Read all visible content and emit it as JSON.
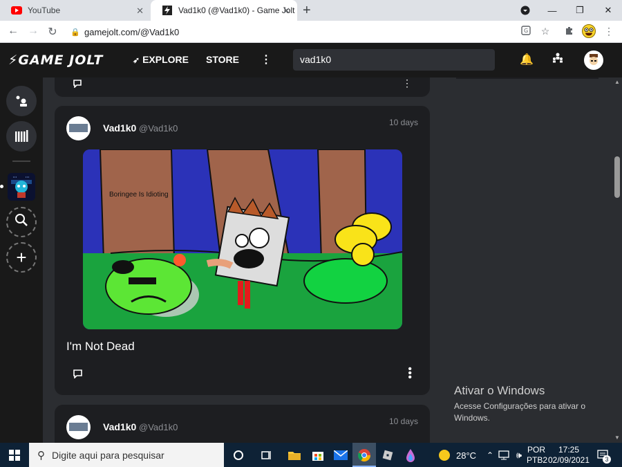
{
  "browser": {
    "tabs": [
      {
        "title": "YouTube",
        "active": false
      },
      {
        "title": "Vad1k0 (@Vad1k0) - Game Jolt",
        "active": true
      }
    ],
    "url": "gamejolt.com/@Vad1k0"
  },
  "site": {
    "logo": "GAME JOLT",
    "nav": {
      "explore": "EXPLORE",
      "store": "STORE"
    },
    "search_value": "vad1k0"
  },
  "posts": [
    {
      "author": "Vad1k0",
      "handle": "@Vad1k0",
      "time": "10 days",
      "media_text": "Boringee Is Idioting",
      "title": "I'm Not Dead"
    },
    {
      "author": "Vad1k0",
      "handle": "@Vad1k0",
      "time": "10 days"
    }
  ],
  "watermark": {
    "title": "Ativar o Windows",
    "subtitle": "Acesse Configurações para ativar o Windows."
  },
  "taskbar": {
    "search_placeholder": "Digite aqui para pesquisar",
    "weather": "28°C",
    "lang_1": "POR",
    "lang_2": "PTB2",
    "time": "17:25",
    "date": "02/09/2021",
    "notifications": "3"
  }
}
